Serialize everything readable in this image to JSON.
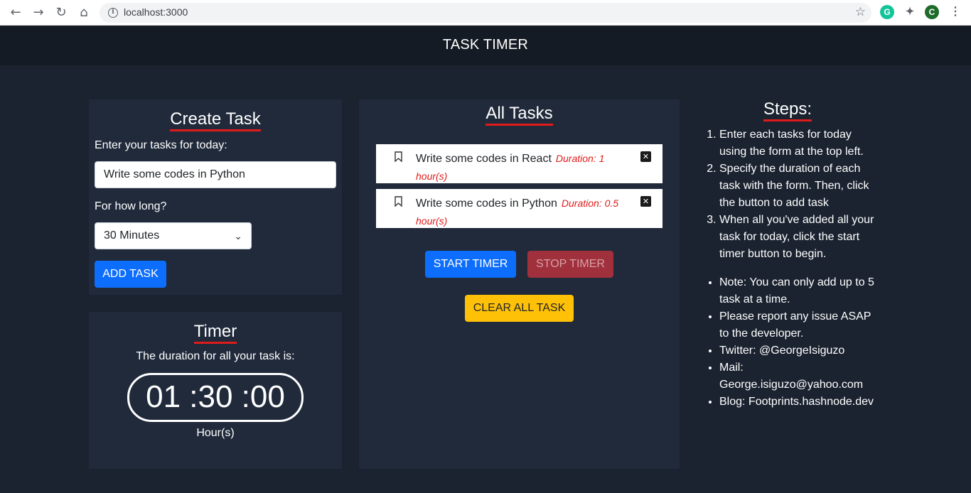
{
  "browser": {
    "url": "localhost:3000",
    "profile_initial": "C"
  },
  "app": {
    "title": "TASK TIMER"
  },
  "create": {
    "heading": "Create Task",
    "task_label": "Enter your tasks for today:",
    "task_value": "Write some codes in Python",
    "duration_label": "For how long?",
    "duration_selected": "30 Minutes",
    "add_button": "ADD TASK"
  },
  "timer": {
    "heading": "Timer",
    "subtitle": "The duration for all your task is:",
    "display": "01 :30 :00",
    "unit": "Hour(s)"
  },
  "tasks": {
    "heading": "All Tasks",
    "items": [
      {
        "text": "Write some codes in React",
        "duration": "Duration: 1 hour(s)"
      },
      {
        "text": "Write some codes in Python",
        "duration": "Duration: 0.5 hour(s)"
      }
    ],
    "start_button": "START TIMER",
    "stop_button": "STOP TIMER",
    "clear_button": "CLEAR ALL TASK"
  },
  "steps": {
    "heading": "Steps:",
    "ordered": [
      "Enter each tasks for today using the form at the top left.",
      "Specify the duration of each task with the form. Then, click the button to add task",
      "When all you've added all your task for today, click the start timer button to begin."
    ],
    "notes": [
      "Note: You can only add up to 5 task at a time.",
      "Please report any issue ASAP to the developer.",
      "Twitter: @GeorgeIsiguzo",
      "Mail: George.isiguzo@yahoo.com",
      "Blog: Footprints.hashnode.dev"
    ]
  },
  "colors": {
    "page_bg": "#1b2330",
    "panel_bg": "#202a3b",
    "header_bg": "#151b24",
    "accent_underline": "#e01b1b",
    "primary": "#0d6efd",
    "danger": "#a1303d",
    "warning": "#ffc107"
  }
}
